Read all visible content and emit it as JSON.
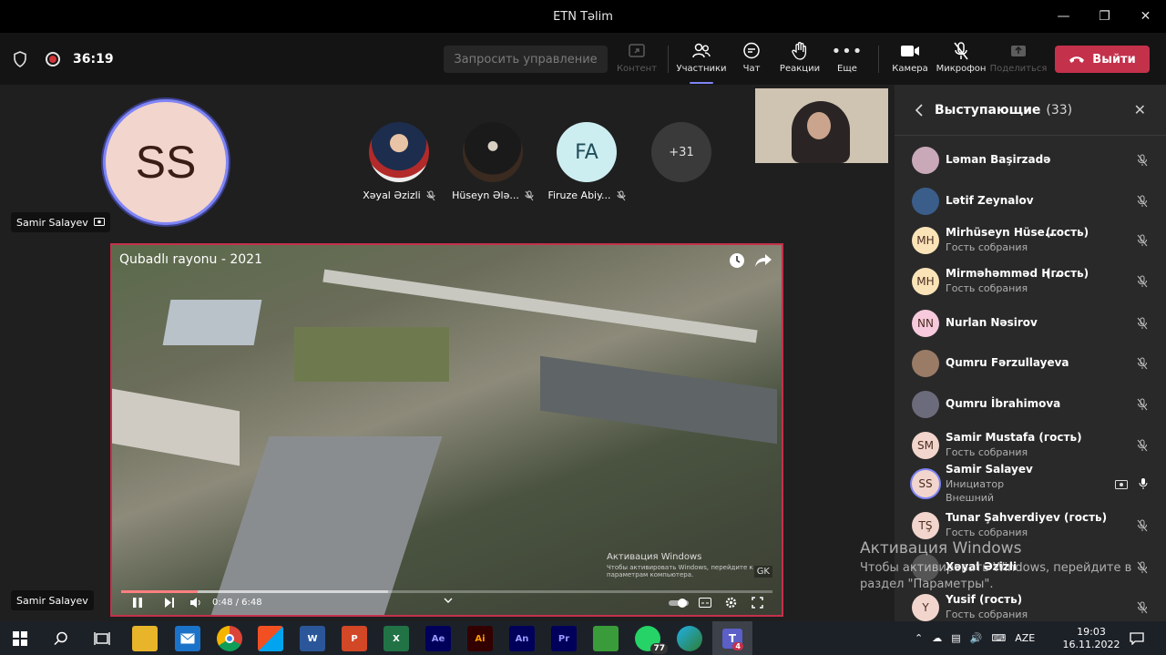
{
  "window": {
    "title": "ETN Təlim"
  },
  "toolbar": {
    "timer": "36:19",
    "request_control": "Запросить управление",
    "buttons": {
      "content": "Контент",
      "participants": "Участники",
      "chat": "Чат",
      "reactions": "Реакции",
      "more": "Еще",
      "camera": "Камера",
      "mic": "Микрофон",
      "share": "Поделиться"
    },
    "leave": "Выйти"
  },
  "stage": {
    "presenter_initials": "SS",
    "presenter_name": "Samir Salayev",
    "participants": [
      {
        "name": "Xəyal Əzizli",
        "initials": ""
      },
      {
        "name": "Hüseyn Ələ...",
        "initials": ""
      },
      {
        "name": "Firuze Abiy...",
        "initials": "FA"
      },
      {
        "name": "",
        "initials": "+31"
      }
    ],
    "video": {
      "title": "Qubadlı rayonu - 2021",
      "time": "0:48 / 6:48",
      "progress_fraction": 0.118,
      "watermark_title": "Активация Windows",
      "watermark_text": "Чтобы активировать Windows, перейдите к параметрам компьютера.",
      "logo": "GK"
    },
    "bottom_name": "Samir Salayev"
  },
  "panel": {
    "title": "Выступающие",
    "count": "(33)",
    "people": [
      {
        "name": "Ləman Başirzadə",
        "sub": "",
        "sub2": "",
        "initials": "",
        "color": "#c9a8b8"
      },
      {
        "name": "Lətif Zeynalov",
        "sub": "",
        "sub2": "",
        "initials": "",
        "color": "#3a5d8a"
      },
      {
        "name": "Mirhüseyn Hüse...",
        "tag": "(гость)",
        "sub": "Гость собрания",
        "sub2": "",
        "initials": "MH",
        "color": "#fbe3b8"
      },
      {
        "name": "Mirməhəmməd H...",
        "tag": "(гость)",
        "sub": "Гость собрания",
        "sub2": "",
        "initials": "MH",
        "color": "#fbe3b8"
      },
      {
        "name": "Nurlan Nəsirov",
        "sub": "",
        "sub2": "",
        "initials": "NN",
        "color": "#f6c9dc"
      },
      {
        "name": "Qumru Fərzullayeva",
        "sub": "",
        "sub2": "",
        "initials": "",
        "color": "#9a7b66"
      },
      {
        "name": "Qumru İbrahimova",
        "sub": "",
        "sub2": "",
        "initials": "",
        "color": "#6b6b7b"
      },
      {
        "name": "Samir Mustafa (гость)",
        "sub": "Гость собрания",
        "sub2": "",
        "initials": "SM",
        "color": "#f2d5cc"
      },
      {
        "name": "Samir Salayev",
        "sub": "Инициатор",
        "sub2": "Внешний",
        "initials": "SS",
        "color": "#f2d5cc"
      },
      {
        "name": "Tunar Şahverdiyev (гость)",
        "sub": "Гость собрания",
        "sub2": "",
        "initials": "TŞ",
        "color": "#f2d5cc"
      },
      {
        "name": "Xəyal Əzizli",
        "sub": "",
        "sub2": "",
        "initials": "",
        "color": "#555"
      },
      {
        "name": "Yusif (гость)",
        "sub": "Гость собрания",
        "sub2": "",
        "initials": "Y",
        "color": "#f2d5cc"
      }
    ]
  },
  "activation": {
    "title": "Активация Windows",
    "text": "Чтобы активировать Windows, перейдите в раздел \"Параметры\"."
  },
  "taskbar": {
    "whatsapp_badge": "77",
    "teams_badge": "4",
    "lang": "AZE",
    "time": "19:03",
    "date": "16.11.2022"
  }
}
